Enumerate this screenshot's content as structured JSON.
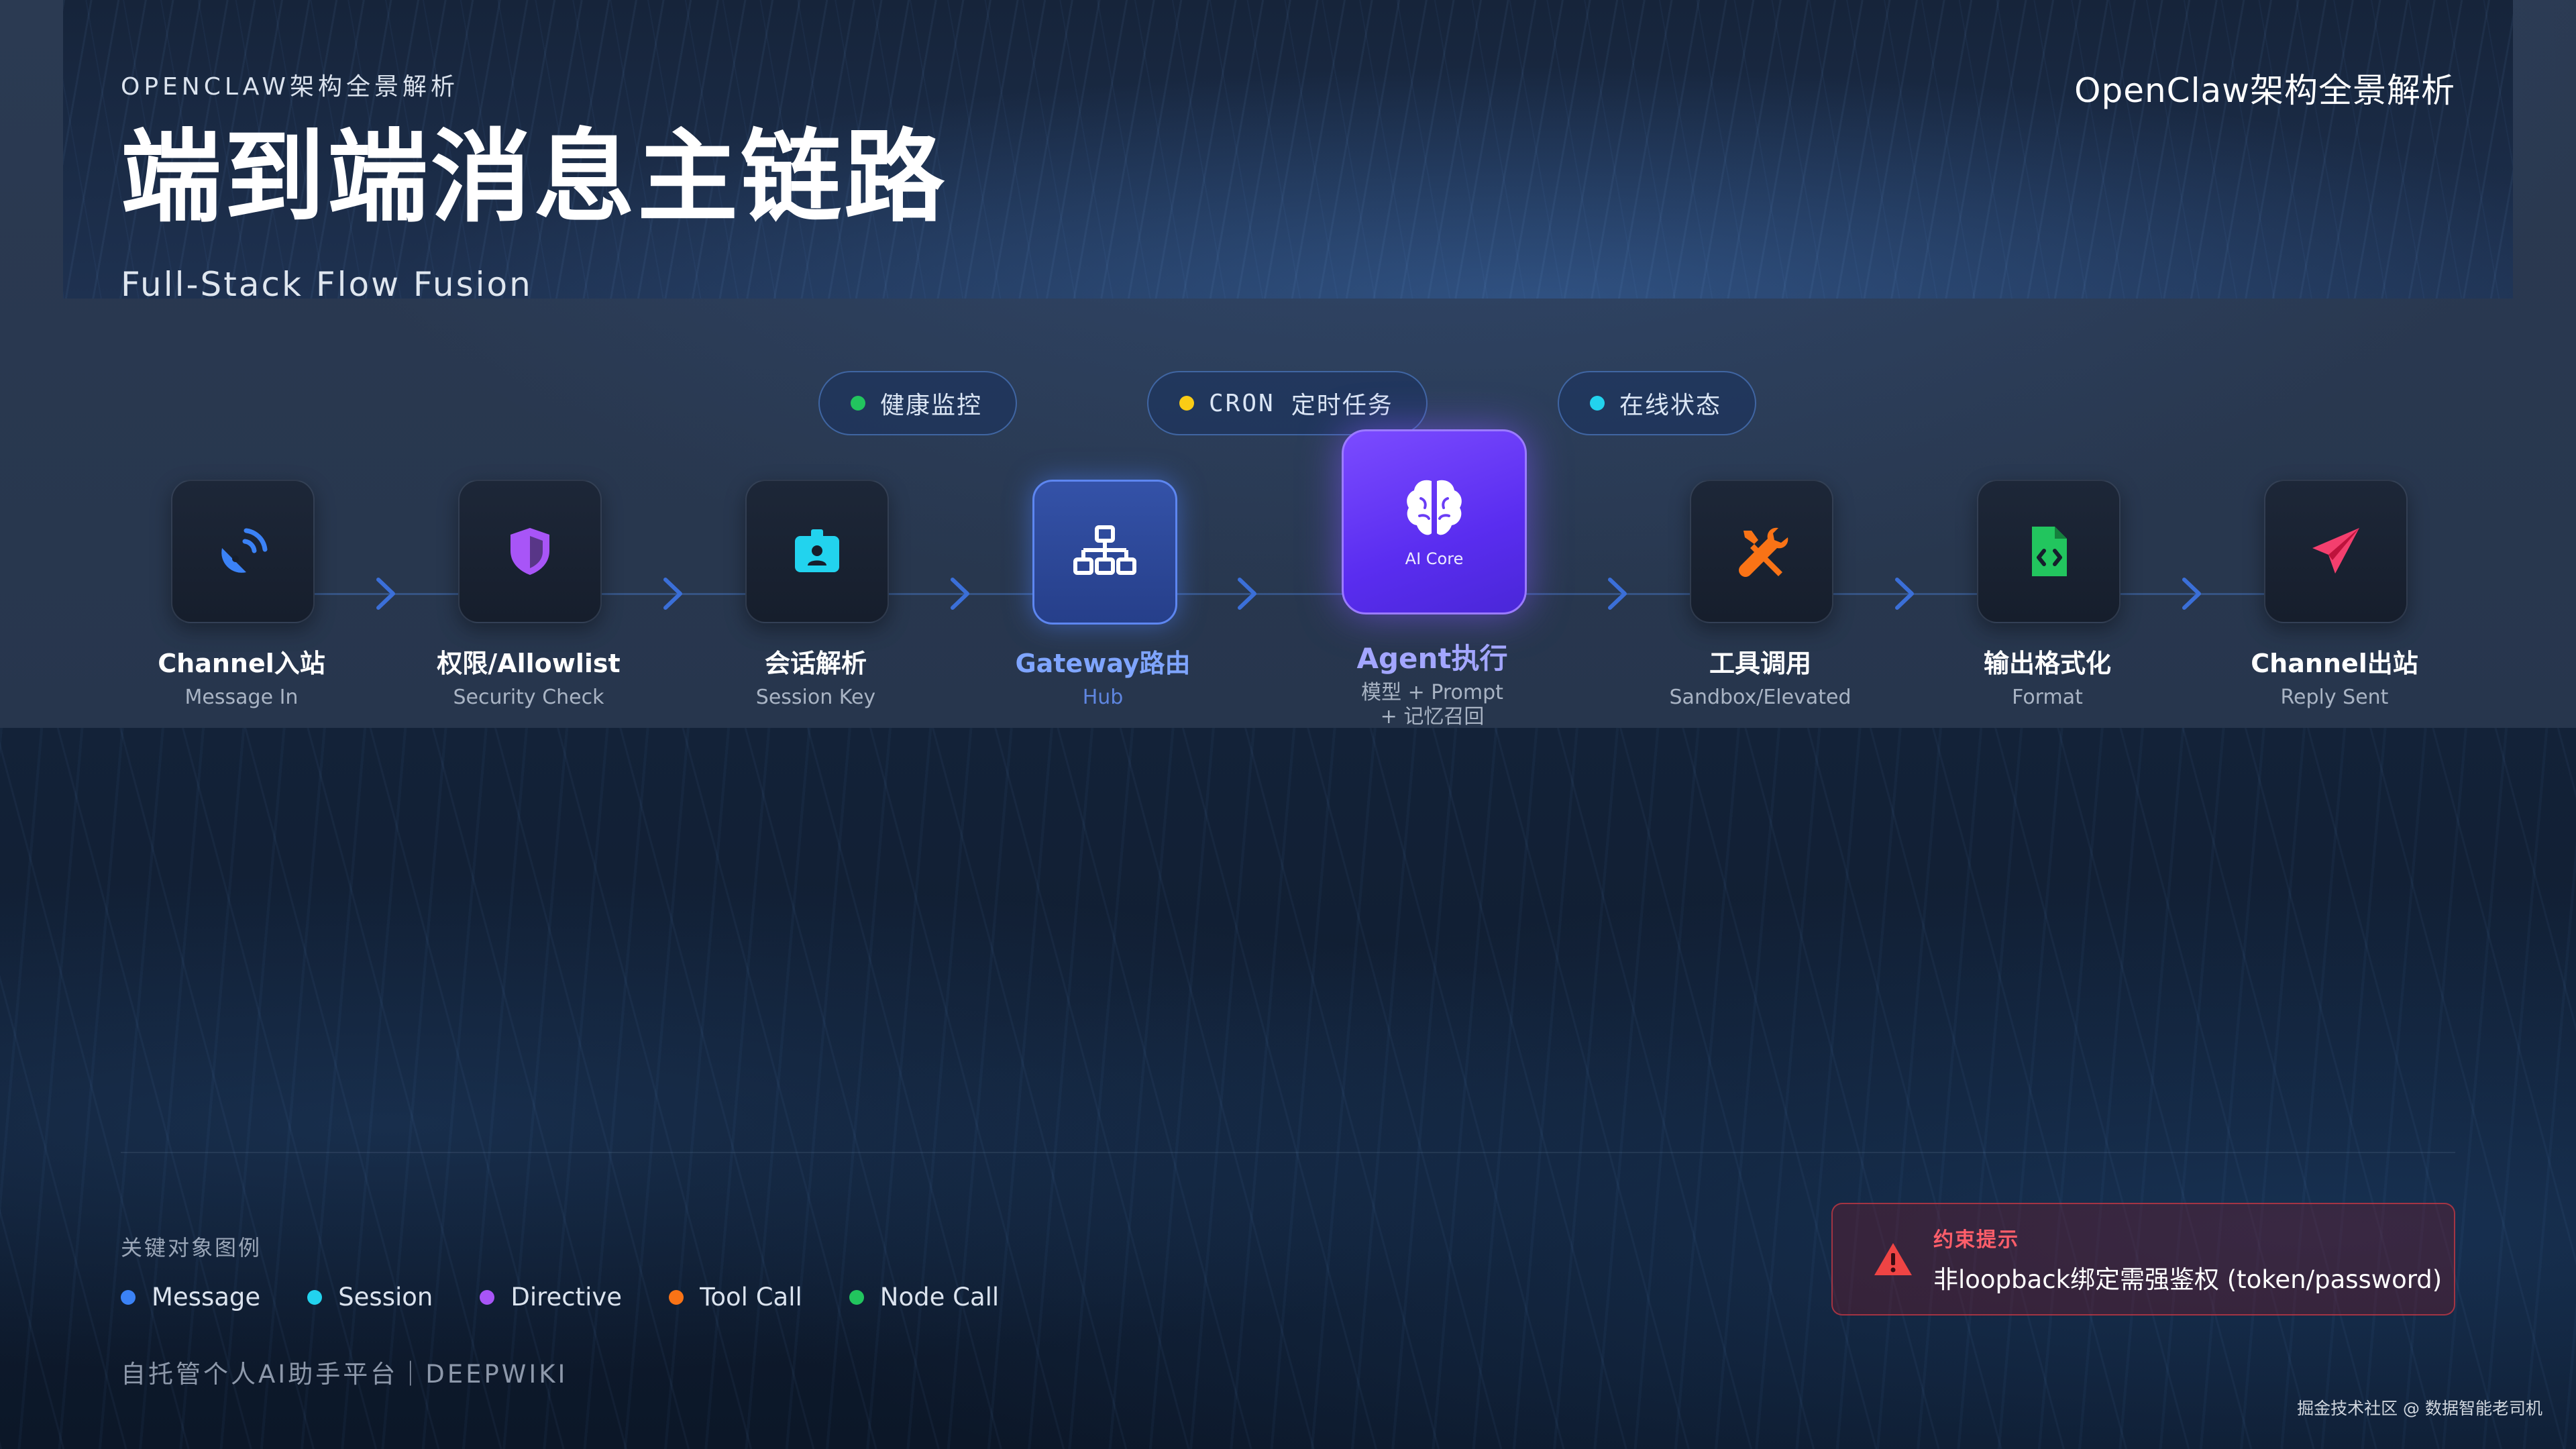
{
  "header": {
    "eyebrow": "OPENCLAW架构全景解析",
    "title": "端到端消息主链路",
    "subtitle": "Full-Stack Flow Fusion",
    "brand": "OpenClaw架构全景解析"
  },
  "pills": [
    {
      "prefix": "",
      "label": "健康监控",
      "dot_color": "#22c55e"
    },
    {
      "prefix": "CRON",
      "label": "定时任务",
      "dot_color": "#facc15"
    },
    {
      "prefix": "",
      "label": "在线状态",
      "dot_color": "#22d3ee"
    }
  ],
  "nodes": [
    {
      "title": "Channel入站",
      "subtitle": "Message In",
      "icon": "satellite-dish-icon",
      "icon_color": "#3b82f6"
    },
    {
      "title": "权限/Allowlist",
      "subtitle": "Security Check",
      "icon": "shield-icon",
      "icon_color": "#a855f7"
    },
    {
      "title": "会话解析",
      "subtitle": "Session Key",
      "icon": "id-badge-icon",
      "icon_color": "#22d3ee"
    },
    {
      "title": "Gateway路由",
      "subtitle": "Hub",
      "icon": "network-icon",
      "icon_color": "#ffffff"
    },
    {
      "title": "Agent执行",
      "subtitle_line1": "模型 + Prompt",
      "subtitle_line2": "+ 记忆召回",
      "icon": "brain-icon",
      "icon_color": "#ffffff",
      "core_label": "AI Core"
    },
    {
      "title": "工具调用",
      "subtitle": "Sandbox/Elevated",
      "icon": "tools-icon",
      "icon_color": "#f97316"
    },
    {
      "title": "输出格式化",
      "subtitle": "Format",
      "icon": "code-file-icon",
      "icon_color": "#22c55e"
    },
    {
      "title": "Channel出站",
      "subtitle": "Reply Sent",
      "icon": "paper-plane-icon",
      "icon_color": "#f43f6e"
    }
  ],
  "legend": {
    "label": "关键对象图例",
    "items": [
      {
        "label": "Message",
        "color": "#3b82f6"
      },
      {
        "label": "Session",
        "color": "#22d3ee"
      },
      {
        "label": "Directive",
        "color": "#a855f7"
      },
      {
        "label": "Tool Call",
        "color": "#f97316"
      },
      {
        "label": "Node Call",
        "color": "#22c55e"
      }
    ]
  },
  "footer": "自托管个人AI助手平台｜DEEPWIKI",
  "alert": {
    "title": "约束提示",
    "body": "非loopback绑定需强鉴权 (token/password)"
  },
  "credit": "掘金技术社区 @ 数据智能老司机"
}
